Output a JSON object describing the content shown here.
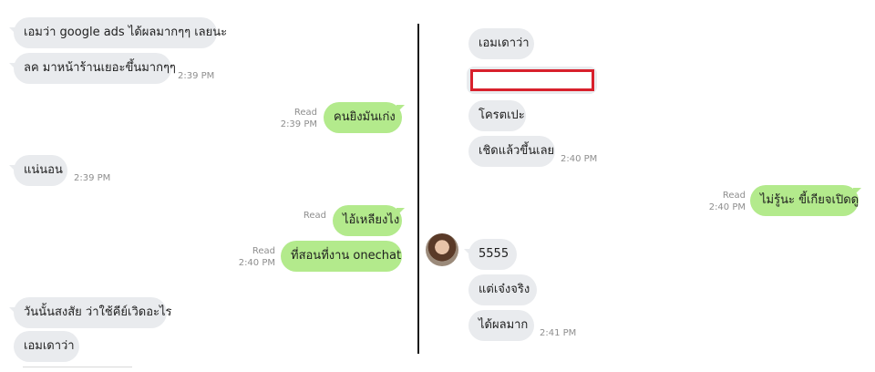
{
  "left_chat": {
    "messages": [
      {
        "text": "เอมว่า google ads ได้ผลมากๆๆ เลยนะ"
      },
      {
        "text": "ลค มาหน้าร้านเยอะขึ้นมากๆๆ",
        "time": "2:39 PM"
      },
      {
        "text": "คนยิงมันเก่ง",
        "read": "Read",
        "time": "2:39 PM"
      },
      {
        "text": "แน่นอน",
        "time": "2:39 PM"
      },
      {
        "text": "ไอ้เหลียงไง",
        "read": "Read"
      },
      {
        "text": "ที่สอนที่งาน onechat",
        "read": "Read",
        "time": "2:40 PM"
      },
      {
        "text": "วันนั้นสงสัย ว่าใช้คีย์เวิดอะไร"
      },
      {
        "text": "เอมเดาว่า"
      }
    ]
  },
  "right_chat": {
    "messages": [
      {
        "text": "เอมเดาว่า"
      },
      {
        "text": "โครตเปะ"
      },
      {
        "text": "เชิดแล้วขึ้นเลย",
        "time": "2:40 PM"
      },
      {
        "text": "ไม่รู้นะ ขี้เกียจเปิดดู",
        "read": "Read",
        "time": "2:40 PM"
      },
      {
        "text": "5555"
      },
      {
        "text": "แต่เจ๋งจริง"
      },
      {
        "text": "ได้ผลมาก",
        "time": "2:41 PM"
      }
    ]
  },
  "colors": {
    "incoming": "#e9ebee",
    "outgoing": "#b3ea8c",
    "redaction": "#d8202c"
  }
}
